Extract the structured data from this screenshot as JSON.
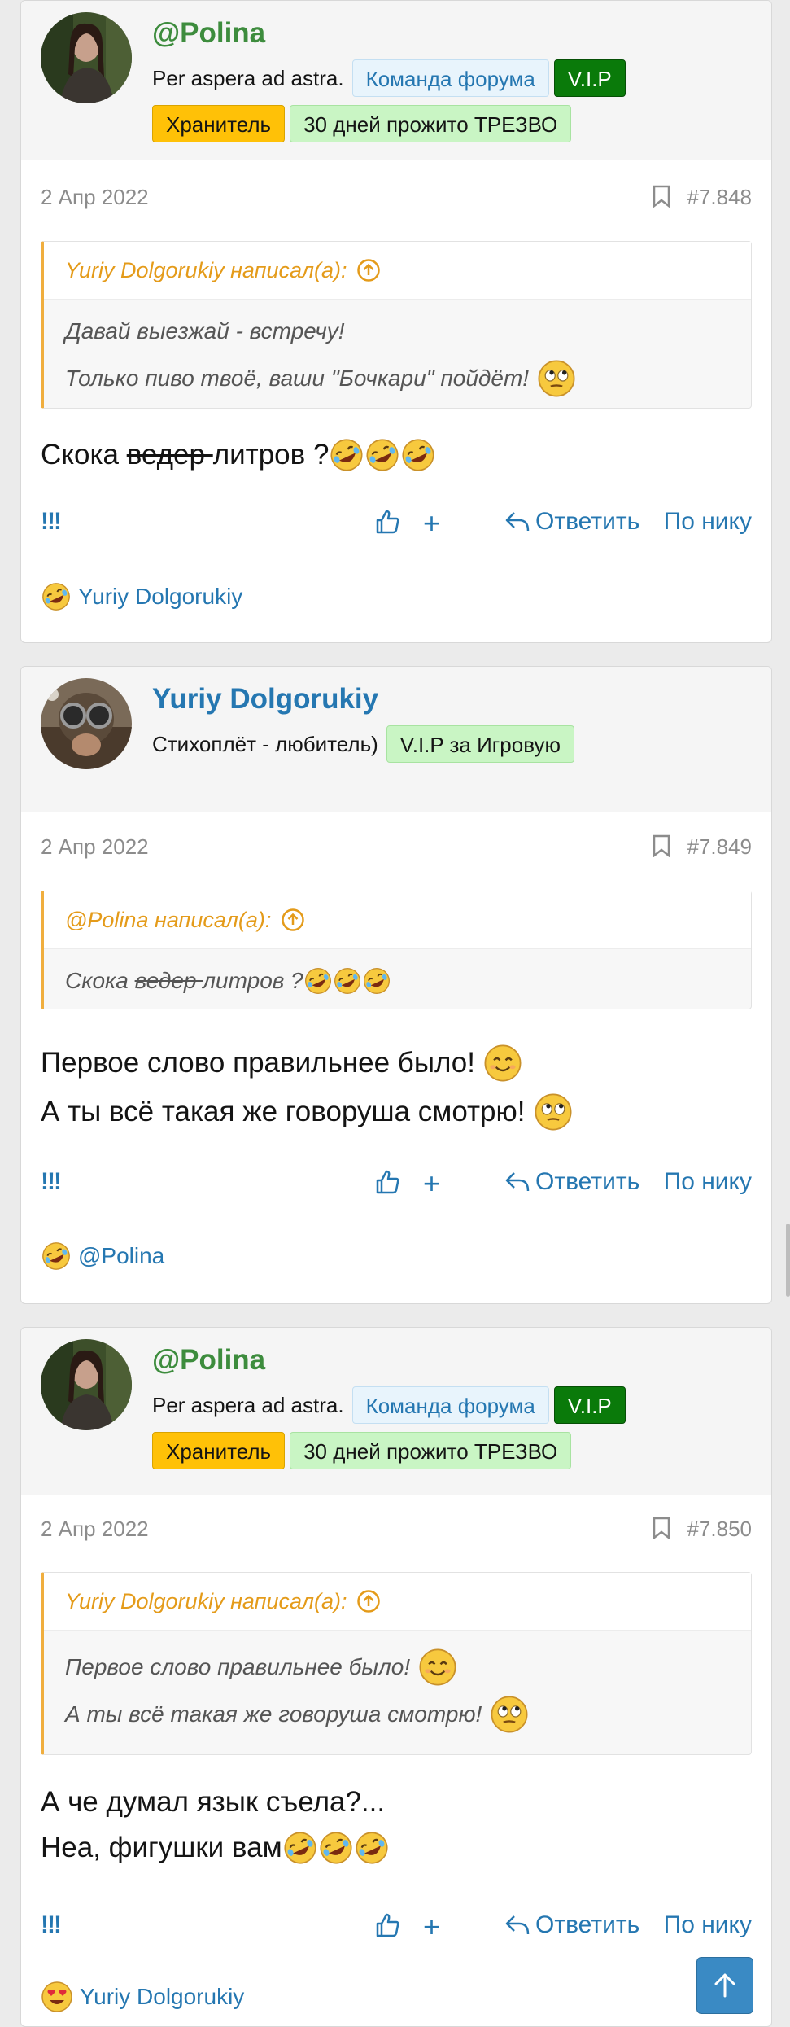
{
  "posts": [
    {
      "author": "@Polina",
      "user_title": "Per aspera ad astra.",
      "badges": [
        "Команда форума",
        "V.I.P",
        "Хранитель",
        "30 дней прожито ТРЕЗВО"
      ],
      "date": "2 Апр 2022",
      "number": "#7.848",
      "quote_author": "Yuriy Dolgorukiy написал(а):",
      "quote_lines": [
        "Давай выезжай - встречу!",
        "Только пиво твоё, ваши \"Бочкари\" пойдёт!"
      ],
      "message_parts": [
        "Скока ",
        "ведер ",
        "литров ?"
      ],
      "reaction_user": "Yuriy Dolgorukiy"
    },
    {
      "author": "Yuriy Dolgorukiy",
      "user_title": "Стихоплёт - любитель)",
      "badges": [
        "V.I.P за Игровую"
      ],
      "date": "2 Апр 2022",
      "number": "#7.849",
      "quote_author": "@Polina написал(а):",
      "quote_parts": [
        "Скока ",
        "ведер ",
        "литров ?"
      ],
      "message_lines": [
        "Первое слово правильнее было!",
        "А ты всё такая же говоруша смотрю!"
      ],
      "reaction_user": "@Polina"
    },
    {
      "author": "@Polina",
      "user_title": "Per aspera ad astra.",
      "badges": [
        "Команда форума",
        "V.I.P",
        "Хранитель",
        "30 дней прожито ТРЕЗВО"
      ],
      "date": "2 Апр 2022",
      "number": "#7.850",
      "quote_author": "Yuriy Dolgorukiy написал(а):",
      "quote_lines": [
        "Первое слово правильнее было!",
        "А ты всё такая же говоруша смотрю!"
      ],
      "message_lines": [
        "А че думал язык съела?...",
        "Неа, фигушки вам"
      ],
      "reaction_user": "Yuriy Dolgorukiy"
    }
  ],
  "actions": {
    "report": "!!!",
    "plus": "+",
    "reply": "Ответить",
    "by_nick": "По нику"
  },
  "colors": {
    "link": "#2577b1",
    "quote_accent": "#f0ae3e",
    "username_green": "#3d8c3d"
  },
  "icons": [
    "bookmark-icon",
    "arrow-up-circle-icon",
    "thumbs-up-icon",
    "reply-icon",
    "arrow-up-icon"
  ]
}
